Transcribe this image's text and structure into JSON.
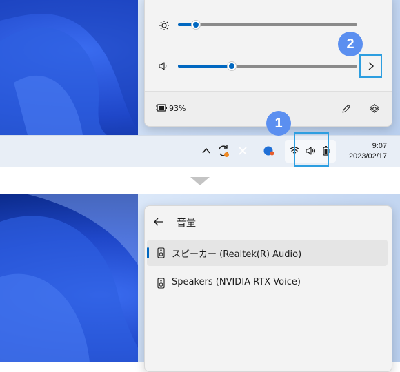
{
  "quick_settings": {
    "brightness_icon": "sun-icon",
    "brightness_level": 0.1,
    "volume_icon": "speaker-icon",
    "volume_level": 0.3,
    "volume_expand_icon": "chevron-right-icon",
    "battery_icon": "battery-charging-icon",
    "battery_percent": "93%",
    "edit_icon": "pencil-icon",
    "settings_icon": "gear-icon"
  },
  "callouts": {
    "badge_1": "1",
    "badge_2": "2",
    "badge_color": "#5b8ff0",
    "box_color": "#2d9ee0"
  },
  "taskbar": {
    "tray_icons": [
      "chevron-up-icon",
      "sync-icon",
      "close-icon",
      "app-icon"
    ],
    "system_icons": [
      "wifi-icon",
      "speaker-icon",
      "battery-charging-icon"
    ],
    "clock_time": "9:07",
    "clock_date": "2023/02/17"
  },
  "volume_panel": {
    "back_icon": "arrow-left-icon",
    "title": "音量",
    "devices": [
      {
        "icon": "speaker-device-icon",
        "label": "スピーカー (Realtek(R) Audio)",
        "selected": true
      },
      {
        "icon": "speaker-device-icon",
        "label": "Speakers (NVIDIA RTX Voice)",
        "selected": false
      }
    ]
  },
  "colors": {
    "accent": "#0067c0",
    "panel_bg": "#f3f3f3"
  }
}
